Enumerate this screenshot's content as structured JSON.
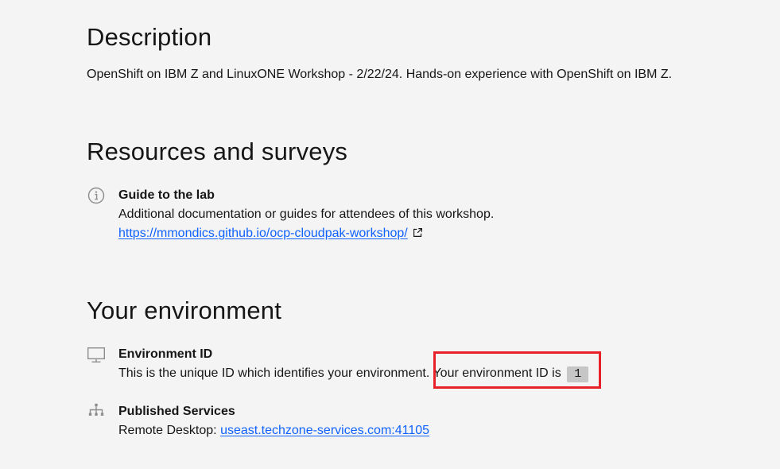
{
  "description": {
    "heading": "Description",
    "text": "OpenShift on IBM Z and LinuxONE Workshop - 2/22/24. Hands-on experience with OpenShift on IBM Z."
  },
  "resources": {
    "heading": "Resources and surveys",
    "items": [
      {
        "icon": "info-icon",
        "title": "Guide to the lab",
        "text": "Additional documentation or guides for attendees of this workshop.",
        "link": "https://mmondics.github.io/ocp-cloudpak-workshop/",
        "link_icon": "external-link-icon"
      }
    ]
  },
  "environment": {
    "heading": "Your environment",
    "env_id": {
      "icon": "desktop-icon",
      "title": "Environment ID",
      "text": "This is the unique ID which identifies your environment.",
      "id_label": " Your environment ID is",
      "id_value": "1"
    },
    "services": {
      "icon": "network-icon",
      "title": "Published Services",
      "label": "Remote Desktop: ",
      "link": "useast.techzone-services.com:41105"
    }
  },
  "colors": {
    "background": "#f4f4f4",
    "text": "#161616",
    "link": "#0f62fe",
    "highlight": "#e7202a",
    "badge": "#c6c6c6"
  }
}
